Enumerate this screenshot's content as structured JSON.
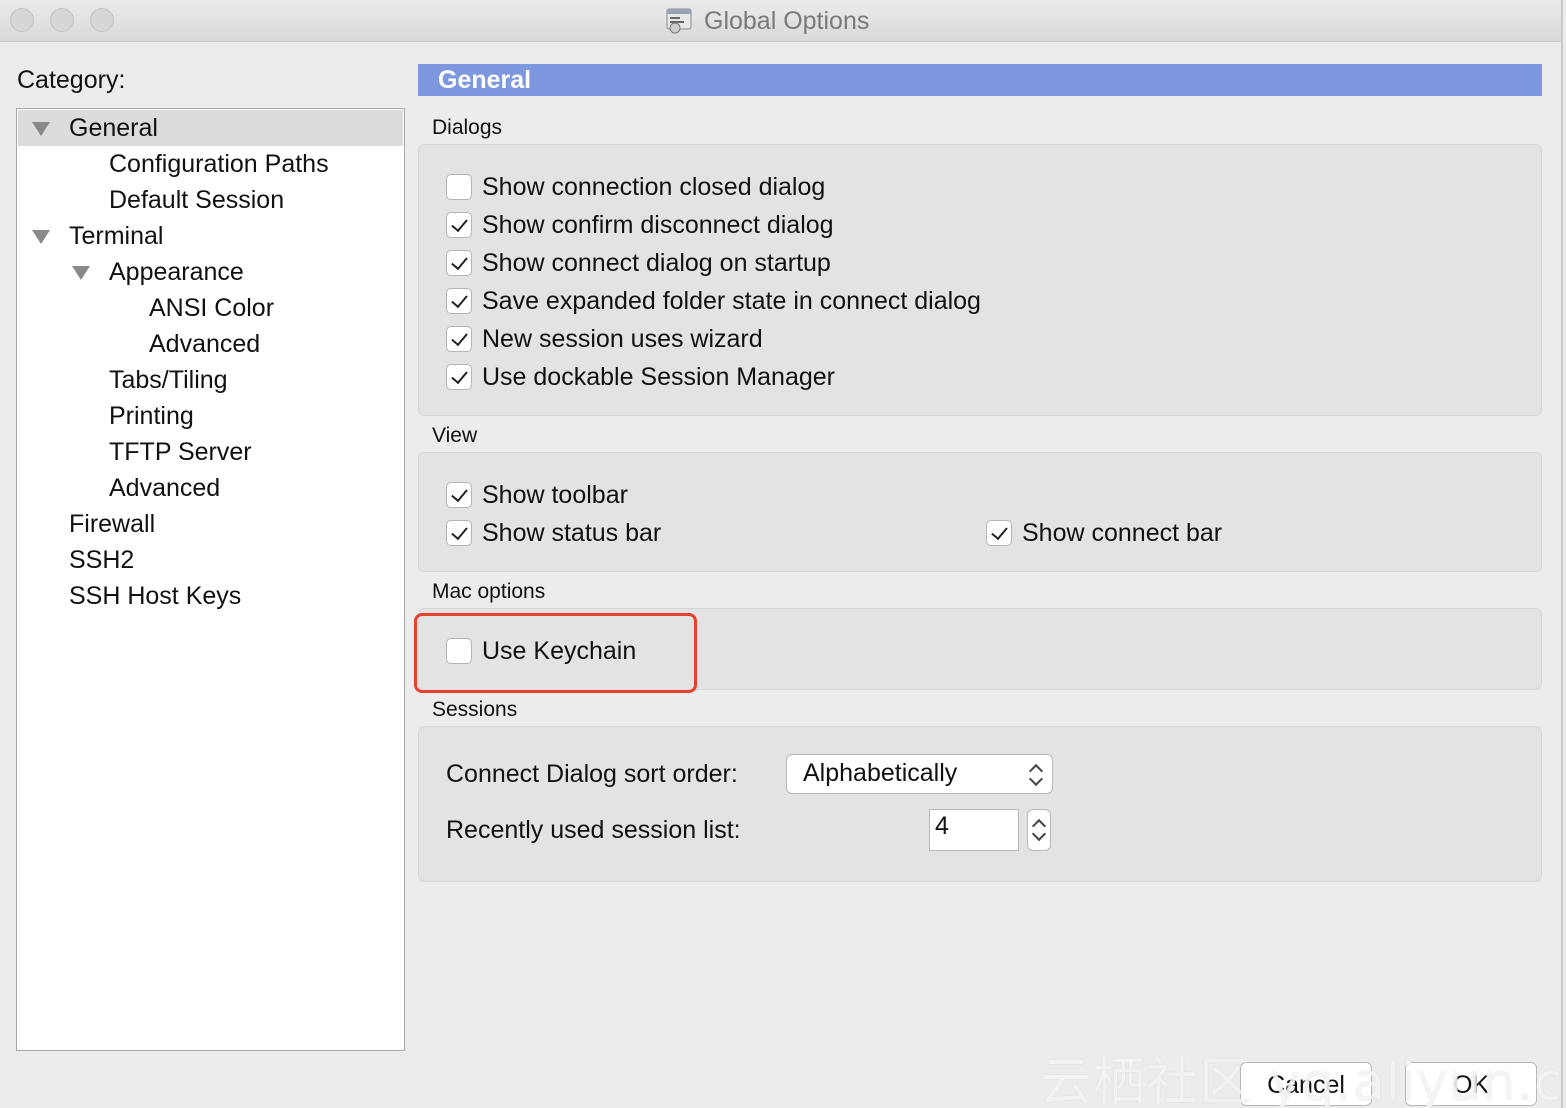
{
  "window": {
    "title": "Global Options"
  },
  "category": {
    "label": "Category:",
    "items": [
      {
        "label": "General",
        "expanded": true,
        "selected": true
      },
      {
        "label": "Configuration Paths"
      },
      {
        "label": "Default Session"
      },
      {
        "label": "Terminal",
        "expanded": true
      },
      {
        "label": "Appearance",
        "expanded": true
      },
      {
        "label": "ANSI Color"
      },
      {
        "label": "Advanced"
      },
      {
        "label": "Tabs/Tiling"
      },
      {
        "label": "Printing"
      },
      {
        "label": "TFTP Server"
      },
      {
        "label": "Advanced"
      },
      {
        "label": "Firewall"
      },
      {
        "label": "SSH2"
      },
      {
        "label": "SSH Host Keys"
      }
    ]
  },
  "panel": {
    "title": "General"
  },
  "dialogs": {
    "label": "Dialogs",
    "options": [
      {
        "label": "Show connection closed dialog",
        "checked": false
      },
      {
        "label": "Show confirm disconnect dialog",
        "checked": true
      },
      {
        "label": "Show connect dialog on startup",
        "checked": true
      },
      {
        "label": "Save expanded folder state in connect dialog",
        "checked": true
      },
      {
        "label": "New session uses wizard",
        "checked": true
      },
      {
        "label": "Use dockable Session Manager",
        "checked": true
      }
    ]
  },
  "view": {
    "label": "View",
    "options": [
      {
        "label": "Show toolbar",
        "checked": true
      },
      {
        "label": "Show status bar",
        "checked": true
      },
      {
        "label": "Show connect bar",
        "checked": true
      }
    ]
  },
  "mac_options": {
    "label": "Mac options",
    "options": [
      {
        "label": "Use Keychain",
        "checked": false
      }
    ]
  },
  "sessions": {
    "label": "Sessions",
    "sort_order_label": "Connect Dialog sort order:",
    "sort_order_value": "Alphabetically",
    "recent_list_label": "Recently used session list:",
    "recent_list_value": "4"
  },
  "buttons": {
    "cancel": "Cancel",
    "ok": "OK"
  },
  "watermark": "云栖社区 yq.aliyun.com",
  "colors": {
    "header": "#7d98de",
    "highlight": "#e5432f"
  }
}
